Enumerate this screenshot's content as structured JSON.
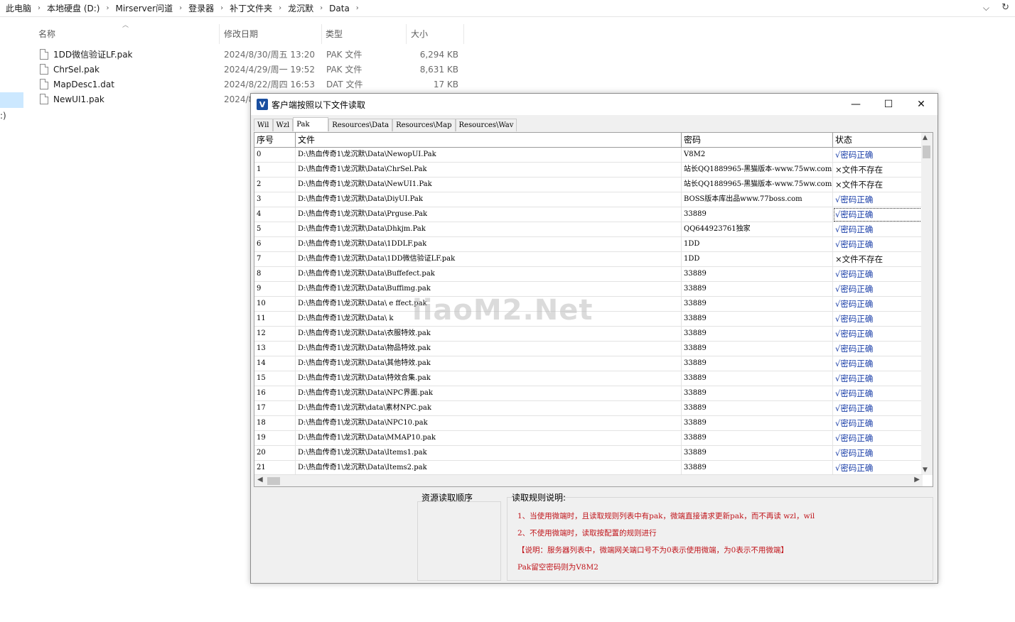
{
  "explorer": {
    "breadcrumb": [
      "此电脑",
      "本地硬盘 (D:)",
      "Mirserver问道",
      "登录器",
      "补丁文件夹",
      "龙沉默",
      "Data"
    ],
    "columns": {
      "name": "名称",
      "date": "修改日期",
      "type": "类型",
      "size": "大小"
    },
    "files": [
      {
        "name": "1DD微信验证LF.pak",
        "date": "2024/8/30/周五 13:20",
        "type": "PAK 文件",
        "size": "6,294 KB"
      },
      {
        "name": "ChrSel.pak",
        "date": "2024/4/29/周一 19:52",
        "type": "PAK 文件",
        "size": "8,631 KB"
      },
      {
        "name": "MapDesc1.dat",
        "date": "2024/8/22/周四 16:53",
        "type": "DAT 文件",
        "size": "17 KB"
      },
      {
        "name": "NewUI1.pak",
        "date": "2024/8",
        "type": "",
        "size": ""
      }
    ],
    "side_text": ":)"
  },
  "dialog": {
    "title": "客户端按照以下文件读取",
    "app_icon_letter": "V",
    "tabs": [
      "Wil",
      "Wzl",
      "Pak",
      "Resources\\Data",
      "Resources\\Map",
      "Resources\\Wav"
    ],
    "active_tab": 2,
    "grid": {
      "headers": [
        "序号",
        "文件",
        "密码",
        "状态"
      ],
      "rows": [
        {
          "idx": "0",
          "file": "D:\\热血传奇1\\龙沉默\\Data\\NewopUI.Pak",
          "pwd": "V8M2",
          "status": "√密码正确",
          "ok": true
        },
        {
          "idx": "1",
          "file": "D:\\热血传奇1\\龙沉默\\Data\\ChrSel.Pak",
          "pwd": "站长QQ1889965-黑猫版本-www.75ww.com",
          "status": "×文件不存在",
          "ok": false
        },
        {
          "idx": "2",
          "file": "D:\\热血传奇1\\龙沉默\\Data\\NewUI1.Pak",
          "pwd": "站长QQ1889965-黑猫版本-www.75ww.com",
          "status": "×文件不存在",
          "ok": false
        },
        {
          "idx": "3",
          "file": "D:\\热血传奇1\\龙沉默\\Data\\DiyUI.Pak",
          "pwd": "BOSS版本库出品www.77boss.com",
          "status": "√密码正确",
          "ok": true
        },
        {
          "idx": "4",
          "file": "D:\\热血传奇1\\龙沉默\\Data\\Prguse.Pak",
          "pwd": "33889",
          "status": "√密码正确",
          "ok": true
        },
        {
          "idx": "5",
          "file": "D:\\热血传奇1\\龙沉默\\Data\\Dhkjm.Pak",
          "pwd": "QQ644923761独家",
          "status": "√密码正确",
          "ok": true
        },
        {
          "idx": "6",
          "file": "D:\\热血传奇1\\龙沉默\\Data\\1DDLF.pak",
          "pwd": "1DD",
          "status": "√密码正确",
          "ok": true
        },
        {
          "idx": "7",
          "file": "D:\\热血传奇1\\龙沉默\\Data\\1DD微信验证LF.pak",
          "pwd": "1DD",
          "status": "×文件不存在",
          "ok": false
        },
        {
          "idx": "8",
          "file": "D:\\热血传奇1\\龙沉默\\Data\\Buffefect.pak",
          "pwd": "33889",
          "status": "√密码正确",
          "ok": true
        },
        {
          "idx": "9",
          "file": "D:\\热血传奇1\\龙沉默\\Data\\Buffimg.pak",
          "pwd": "33889",
          "status": "√密码正确",
          "ok": true
        },
        {
          "idx": "10",
          "file": "D:\\热血传奇1\\龙沉默\\Data\\   e  ffect.pak",
          "pwd": "33889",
          "status": "√密码正确",
          "ok": true
        },
        {
          "idx": "11",
          "file": "D:\\热血传奇1\\龙沉默\\Data\\      k",
          "pwd": "33889",
          "status": "√密码正确",
          "ok": true
        },
        {
          "idx": "12",
          "file": "D:\\热血传奇1\\龙沉默\\Data\\衣服特效.pak",
          "pwd": "33889",
          "status": "√密码正确",
          "ok": true
        },
        {
          "idx": "13",
          "file": "D:\\热血传奇1\\龙沉默\\Data\\物品特效.pak",
          "pwd": "33889",
          "status": "√密码正确",
          "ok": true
        },
        {
          "idx": "14",
          "file": "D:\\热血传奇1\\龙沉默\\Data\\其他特效.pak",
          "pwd": "33889",
          "status": "√密码正确",
          "ok": true
        },
        {
          "idx": "15",
          "file": "D:\\热血传奇1\\龙沉默\\Data\\特效合集.pak",
          "pwd": "33889",
          "status": "√密码正确",
          "ok": true
        },
        {
          "idx": "16",
          "file": "D:\\热血传奇1\\龙沉默\\Data\\NPC界面.pak",
          "pwd": "33889",
          "status": "√密码正确",
          "ok": true
        },
        {
          "idx": "17",
          "file": "D:\\热血传奇1\\龙沉默\\data\\素材NPC.pak",
          "pwd": "33889",
          "status": "√密码正确",
          "ok": true
        },
        {
          "idx": "18",
          "file": "D:\\热血传奇1\\龙沉默\\Data\\NPC10.pak",
          "pwd": "33889",
          "status": "√密码正确",
          "ok": true
        },
        {
          "idx": "19",
          "file": "D:\\热血传奇1\\龙沉默\\Data\\MMAP10.pak",
          "pwd": "33889",
          "status": "√密码正确",
          "ok": true
        },
        {
          "idx": "20",
          "file": "D:\\热血传奇1\\龙沉默\\Data\\Items1.pak",
          "pwd": "33889",
          "status": "√密码正确",
          "ok": true
        },
        {
          "idx": "21",
          "file": "D:\\热血传奇1\\龙沉默\\Data\\Items2.pak",
          "pwd": "33889",
          "status": "√密码正确",
          "ok": true
        }
      ]
    },
    "watermark": "iiaoM2.Net",
    "panel_left_label": "资源读取顺序",
    "panel_right_label": "读取规则说明:",
    "rules": [
      "1、当使用微端时，且读取规则列表中有pak，微端直接请求更新pak，而不再读 wzl，wil",
      "2、不使用微端时，读取按配置的规则进行",
      "【说明：服务器列表中，微端网关端口号不为0表示使用微端，为0表示不用微端】",
      "Pak留空密码则为V8M2"
    ],
    "colors": {
      "ok_status": "#1a3ea8",
      "rule_text": "#c0141a",
      "app_icon": "#1a4fa0"
    }
  }
}
